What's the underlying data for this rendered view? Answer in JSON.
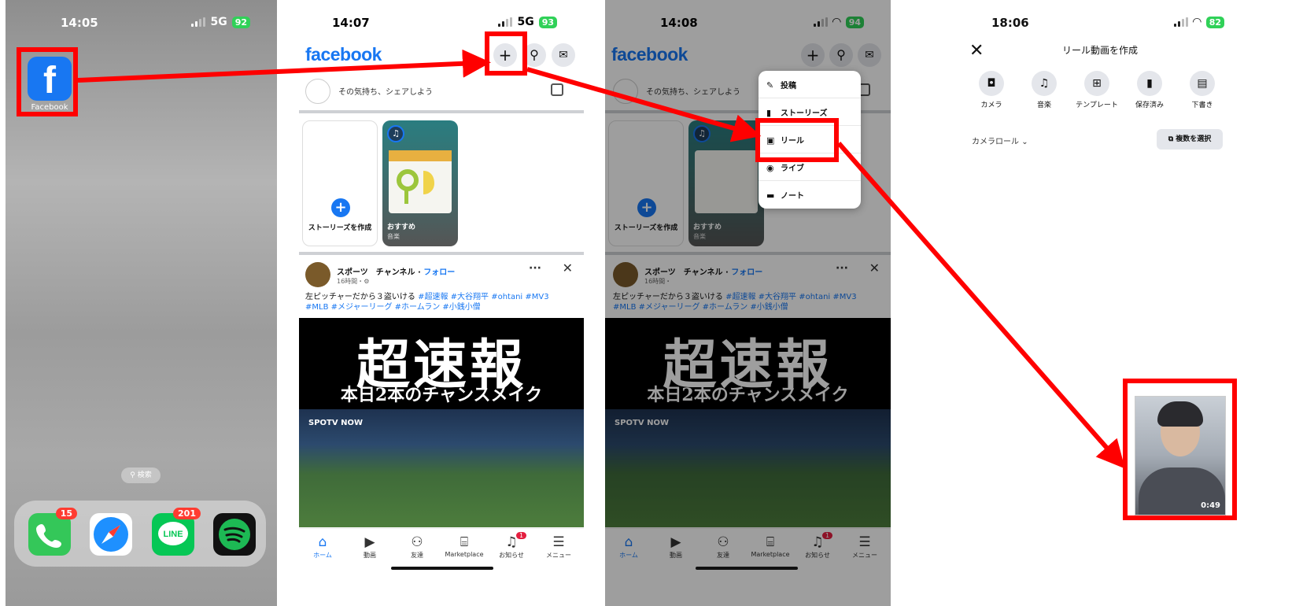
{
  "colors": {
    "fb_blue": "#1877f2",
    "annotation_red": "#ff0000",
    "battery_green": "#30d158",
    "notification_red": "#e41e3f"
  },
  "panel1": {
    "status": {
      "time": "14:05",
      "network": "5G",
      "battery": "92"
    },
    "app_label": "Facebook",
    "search_label": "検索",
    "dock": [
      {
        "name": "phone",
        "badge": "15"
      },
      {
        "name": "safari",
        "badge": ""
      },
      {
        "name": "line",
        "label": "LINE",
        "badge": "201"
      },
      {
        "name": "spotify",
        "badge": ""
      }
    ]
  },
  "panel2": {
    "status": {
      "time": "14:07",
      "network": "5G",
      "battery": "93"
    },
    "logo": "facebook",
    "composer_placeholder": "その気持ち、シェアしよう",
    "story_create_label": "ストーリーズを作成",
    "story_music_title": "おすすめ",
    "story_music_sub": "音楽",
    "post": {
      "author": "スポーツ　チャンネル",
      "follow": "フォロー",
      "time": "16時間・",
      "text": "左ピッチャーだから３盗いける",
      "tags": "#超速報 #大谷翔平 #ohtani #MV3 #MLB #メジャーリーグ #ホームラン #小銭小僧",
      "video_title": "超速報",
      "video_subtitle": "本日2本のチャンスメイク",
      "video_logo": "SPOTV NOW"
    },
    "nav": [
      {
        "icon": "home-icon",
        "label": "ホーム"
      },
      {
        "icon": "video-icon",
        "label": "動画"
      },
      {
        "icon": "friends-icon",
        "label": "友達"
      },
      {
        "icon": "marketplace-icon",
        "label": "Marketplace"
      },
      {
        "icon": "bell-icon",
        "label": "お知らせ",
        "badge": "1"
      },
      {
        "icon": "menu-icon",
        "label": "メニュー"
      }
    ]
  },
  "panel3": {
    "status": {
      "time": "14:08",
      "battery": "94"
    },
    "menu": [
      {
        "icon": "edit-icon",
        "label": "投稿"
      },
      {
        "icon": "book-icon",
        "label": "ストーリーズ"
      },
      {
        "icon": "reel-icon",
        "label": "リール"
      },
      {
        "icon": "live-icon",
        "label": "ライブ"
      },
      {
        "icon": "note-icon",
        "label": "ノート"
      }
    ]
  },
  "panel4": {
    "status": {
      "time": "18:06",
      "battery": "82"
    },
    "title": "リール動画を作成",
    "tools": [
      {
        "icon": "camera-icon",
        "label": "カメラ"
      },
      {
        "icon": "music-icon",
        "label": "音楽"
      },
      {
        "icon": "template-icon",
        "label": "テンプレート"
      },
      {
        "icon": "bookmark-icon",
        "label": "保存済み"
      },
      {
        "icon": "draft-icon",
        "label": "下書き"
      }
    ],
    "camera_roll": "カメラロール",
    "multi_select": "複数を選択",
    "video_duration": "0:49"
  }
}
